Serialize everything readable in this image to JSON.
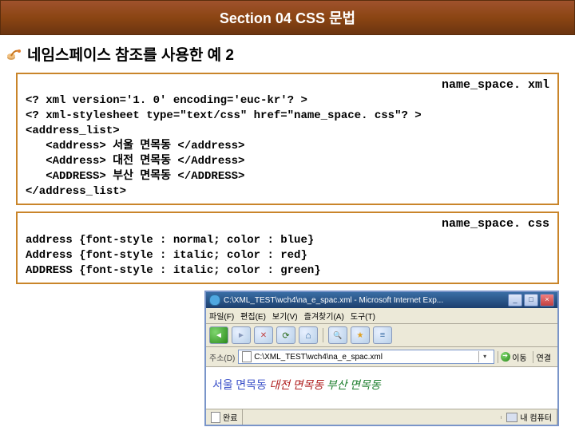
{
  "banner": {
    "title": "Section 04 CSS 문법"
  },
  "section": {
    "heading": "네임스페이스 참조를 사용한 예 2"
  },
  "codebox1": {
    "filename": "name_space. xml",
    "lines": [
      "<? xml version='1. 0' encoding='euc-kr'? >",
      "<? xml-stylesheet type=\"text/css\" href=\"name_space. css\"? >",
      "<address_list>",
      "   <address> 서울 면목동 </address>",
      "   <Address> 대전 면목동 </Address>",
      "   <ADDRESS> 부산 면목동 </ADDRESS>",
      "</address_list>"
    ]
  },
  "codebox2": {
    "filename": "name_space. css",
    "lines": [
      "address {font-style : normal; color : blue}",
      "Address {font-style : italic; color : red}",
      "ADDRESS {font-style : italic; color : green}"
    ]
  },
  "browser": {
    "title": "C:\\XML_TEST\\wch4\\na_e_spac.xml - Microsoft Internet Exp...",
    "menus": [
      "파일(F)",
      "편집(E)",
      "보기(V)",
      "즐겨찾기(A)",
      "도구(T)"
    ],
    "addr_label": "주소(D)",
    "addr_value": "C:\\XML_TEST\\wch4\\na_e_spac.xml",
    "go": "이동",
    "links": "연결",
    "content": {
      "w1": "서울 면목동",
      "w2": "대전 면목동",
      "w3": "부산 면목동"
    },
    "status_done": "완료",
    "status_zone": "내 컴퓨터"
  }
}
